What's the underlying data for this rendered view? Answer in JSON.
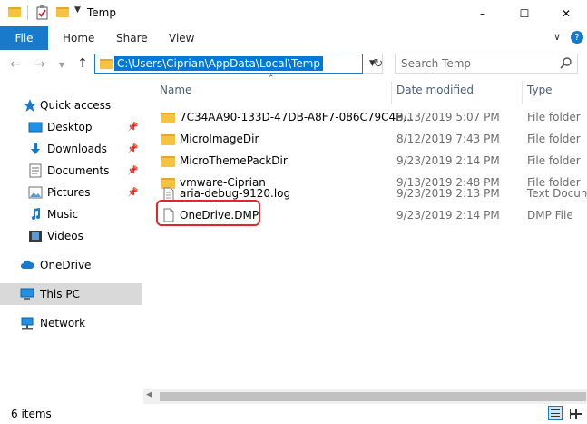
{
  "window": {
    "title": "Temp",
    "minimize_label": "–",
    "maximize_label": "☐",
    "close_label": "✕"
  },
  "ribbon": {
    "tabs": [
      "File",
      "Home",
      "Share",
      "View"
    ],
    "expand_label": "∨",
    "help_label": "?"
  },
  "address": {
    "path": "C:\\Users\\Ciprian\\AppData\\Local\\Temp",
    "search_placeholder": "Search Temp"
  },
  "sidebar": {
    "items": [
      {
        "label": "Quick access",
        "icon": "star-icon"
      },
      {
        "label": "Desktop",
        "icon": "desktop-icon",
        "pinned": true
      },
      {
        "label": "Downloads",
        "icon": "download-icon",
        "pinned": true
      },
      {
        "label": "Documents",
        "icon": "documents-icon",
        "pinned": true
      },
      {
        "label": "Pictures",
        "icon": "pictures-icon",
        "pinned": true
      },
      {
        "label": "Music",
        "icon": "music-icon"
      },
      {
        "label": "Videos",
        "icon": "videos-icon"
      },
      {
        "label": "OneDrive",
        "icon": "cloud-icon"
      },
      {
        "label": "This PC",
        "icon": "computer-icon"
      },
      {
        "label": "Network",
        "icon": "network-icon"
      }
    ]
  },
  "columns": {
    "name": "Name",
    "date": "Date modified",
    "type": "Type"
  },
  "files": [
    {
      "name": "7C34AA90-133D-47DB-A8F7-086C79C4B...",
      "date": "9/13/2019 5:07 PM",
      "type": "File folder",
      "kind": "folder"
    },
    {
      "name": "MicroImageDir",
      "date": "8/12/2019 7:43 PM",
      "type": "File folder",
      "kind": "folder"
    },
    {
      "name": "MicroThemePackDir",
      "date": "9/23/2019 2:14 PM",
      "type": "File folder",
      "kind": "folder"
    },
    {
      "name": "vmware-Ciprian",
      "date": "9/13/2019 2:48 PM",
      "type": "File folder",
      "kind": "folder"
    },
    {
      "name": "aria-debug-9120.log",
      "date": "9/23/2019 2:13 PM",
      "type": "Text Docume",
      "kind": "text"
    },
    {
      "name": "OneDrive.DMP",
      "date": "9/23/2019 2:14 PM",
      "type": "DMP File",
      "kind": "file"
    }
  ],
  "status": {
    "item_count": "6 items"
  },
  "colors": {
    "accent": "#1979ca",
    "selection": "#0078d7",
    "folder": "#f5c242",
    "highlight_ring": "#e3262d"
  }
}
